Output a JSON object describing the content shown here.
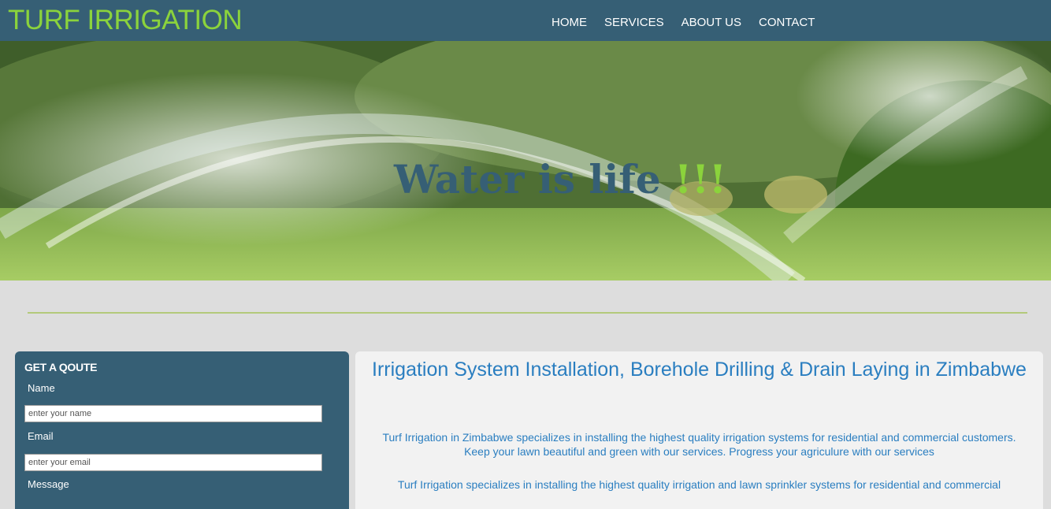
{
  "brand": "TURF IRRIGATION",
  "nav": [
    "HOME",
    "SERVICES",
    "ABOUT US",
    "CONTACT"
  ],
  "hero": {
    "title": "Water is life ",
    "title_accent": "!!!"
  },
  "quote_form": {
    "heading": "GET A QOUTE",
    "name_label": "Name",
    "name_placeholder": "enter your name",
    "email_label": "Email",
    "email_placeholder": "enter your email",
    "message_label": "Message"
  },
  "content": {
    "heading": "Irrigation System Installation, Borehole Drilling & Drain Laying in Zimbabwe",
    "paragraph1_line1": "Turf Irrigation in Zimbabwe specializes in installing the highest quality irrigation systems for residential and commercial customers.",
    "paragraph1_line2": "Keep your lawn beautiful and green with our services. Progress your agriculure with our services",
    "paragraph2": "Turf Irrigation specializes in installing the highest quality irrigation and lawn sprinkler systems for residential and commercial"
  },
  "colors": {
    "header_bg": "#365f75",
    "brand_green": "#8bd33c",
    "link_blue": "#2a7ec0",
    "page_bg": "#dddddd"
  }
}
